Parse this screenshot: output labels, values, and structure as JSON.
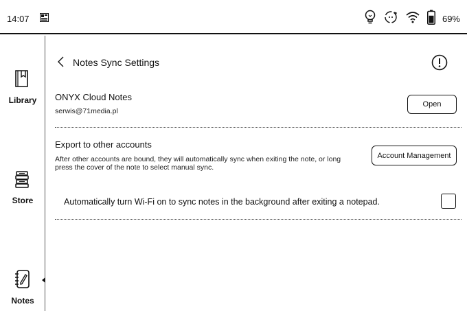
{
  "status_bar": {
    "time": "14:07",
    "battery_percent": "69%",
    "battery_level": 0.69,
    "icons": [
      "app-notification-icon",
      "lightbulb-icon",
      "sync-icon",
      "wifi-icon",
      "battery-icon"
    ]
  },
  "sidebar": {
    "items": [
      {
        "label": "Library",
        "icon": "library-icon"
      },
      {
        "label": "Store",
        "icon": "store-icon"
      },
      {
        "label": "Notes",
        "icon": "notes-icon",
        "active": true
      }
    ]
  },
  "header": {
    "title": "Notes Sync Settings"
  },
  "onyx_cloud": {
    "title": "ONYX Cloud Notes",
    "account": "serwis@71media.pl",
    "open_label": "Open"
  },
  "export": {
    "title": "Export to other accounts",
    "description_line1": "After other accounts are bound, they will automatically sync when exiting the note, or long",
    "description_line2": "press the cover of the note to select manual sync.",
    "account_management_label": "Account Management"
  },
  "wifi_option": {
    "label": "Automatically turn Wi-Fi on to sync notes in the background after exiting a notepad.",
    "checked": false
  }
}
